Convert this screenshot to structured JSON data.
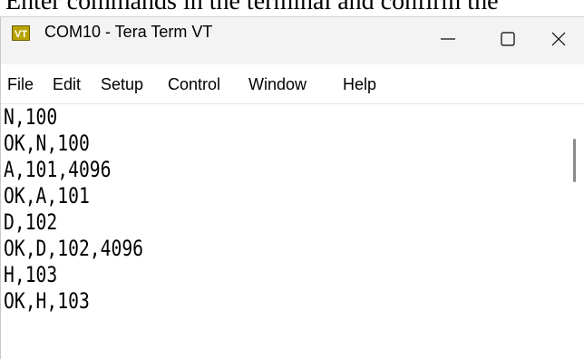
{
  "caption": "Enter commands in the terminal and confirm the",
  "window": {
    "title": "COM10 - Tera Term VT",
    "icon": "tera-term-vt-icon",
    "icon_text": "VT",
    "controls": {
      "minimize": "minimize-icon",
      "maximize": "maximize-icon",
      "close": "close-icon"
    }
  },
  "menu": [
    "File",
    "Edit",
    "Setup",
    "Control",
    "Window",
    "Help"
  ],
  "terminal": {
    "lines": [
      "N,100",
      "OK,N,100",
      "A,101,4096",
      "OK,A,101",
      "D,102",
      "OK,D,102,4096",
      "H,103",
      "OK,H,103"
    ]
  },
  "colors": {
    "titlebar": "#f3f3f3",
    "icon_bg": "#b9a300",
    "text": "#000000"
  }
}
